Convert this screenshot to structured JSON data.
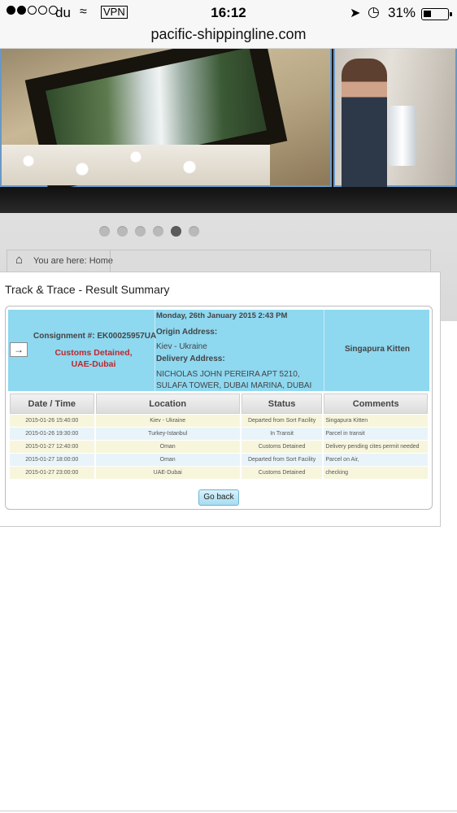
{
  "status_bar": {
    "carrier": "du",
    "vpn": "VPN",
    "time": "16:12",
    "battery": "31%"
  },
  "browser": {
    "url": "pacific-shippingline.com"
  },
  "slider": {
    "dot_count": 6,
    "active_index": 4
  },
  "breadcrumb": {
    "text": "You are here: Home"
  },
  "panel": {
    "title": "Track & Trace - Result Summary"
  },
  "shipment": {
    "consignment": "Consignment #: EK00025957UA",
    "status_line1": "Customs Detained,",
    "status_line2": "UAE-Dubai",
    "date": "Monday, 26th January 2015 2:43 PM",
    "origin_label": "Origin Address:",
    "origin": "Kiev - Ukraine",
    "delivery_label": "Delivery Address:",
    "delivery": "NICHOLAS JOHN PEREIRA APT 5210, SULAFA TOWER, DUBAI MARINA, DUBAI",
    "item": "Singapura Kitten"
  },
  "table": {
    "headers": [
      "Date / Time",
      "Location",
      "Status",
      "Comments"
    ],
    "rows": [
      {
        "date": "2015-01-26 15:40:00",
        "location": "Kiev - Ukraine",
        "status": "Departed from Sort Facility",
        "comment": "Singapura Kitten"
      },
      {
        "date": "2015-01-26 19:30:00",
        "location": "Turkey-Istanbul",
        "status": "In Transit",
        "comment": "Parcel in transit"
      },
      {
        "date": "2015-01-27 12:40:00",
        "location": "Oman",
        "status": "Customs Detained",
        "comment": "Delivery pending cites permit needed"
      },
      {
        "date": "2015-01-27 18:00:00",
        "location": "Oman",
        "status": "Departed from Sort Facility",
        "comment": "Parcel on Air,"
      },
      {
        "date": "2015-01-27 23:00:00",
        "location": "UAE-Dubai",
        "status": "Customs Detained",
        "comment": "checking"
      }
    ]
  },
  "buttons": {
    "go_back": "Go back"
  },
  "icons": {
    "home": "home-icon",
    "arrow": "arrow-icon",
    "wifi": "wifi-icon",
    "location": "location-arrow-icon",
    "alarm": "alarm-icon"
  },
  "colors": {
    "header_row": "#8ed8f0",
    "status_red": "#c0262c",
    "row_yellow": "#f7f6dd",
    "row_blue": "#e8f4f9"
  }
}
